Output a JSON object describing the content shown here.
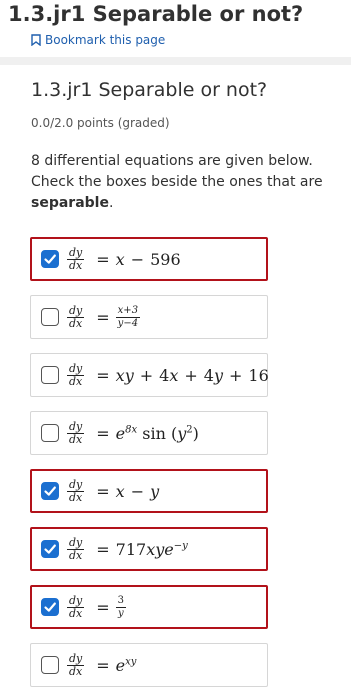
{
  "page_title": "1.3.jr1 Separable or not?",
  "bookmark_label": "Bookmark this page",
  "problem": {
    "title": "1.3.jr1 Separable or not?",
    "points": "0.0/2.0 points (graded)",
    "prompt_lead": "8 differential equations are given below. Check the boxes beside the ones that are",
    "prompt_bold": "separable",
    "prompt_tail": "."
  },
  "lhs": {
    "num": "dy",
    "den": "dx"
  },
  "options": [
    {
      "checked": true,
      "text": "dy/dx = x − 596"
    },
    {
      "checked": false,
      "text": "dy/dx = (x+3)/(y−4)"
    },
    {
      "checked": false,
      "text": "dy/dx = xy + 4x + 4y + 16"
    },
    {
      "checked": false,
      "text": "dy/dx = e^(8x) sin(y^2)"
    },
    {
      "checked": true,
      "text": "dy/dx = x − y"
    },
    {
      "checked": true,
      "text": "dy/dx = 717xye^(−y)"
    },
    {
      "checked": true,
      "text": "dy/dx = 3/y"
    },
    {
      "checked": false,
      "text": "dy/dx = e^(xy)"
    }
  ],
  "icons": {
    "checkbox_checked": "checkmark-icon",
    "bookmark": "bookmark-icon"
  },
  "colors": {
    "accent": "#1b6fd0",
    "checked_border": "#b2121a",
    "link": "#1f5fae"
  }
}
